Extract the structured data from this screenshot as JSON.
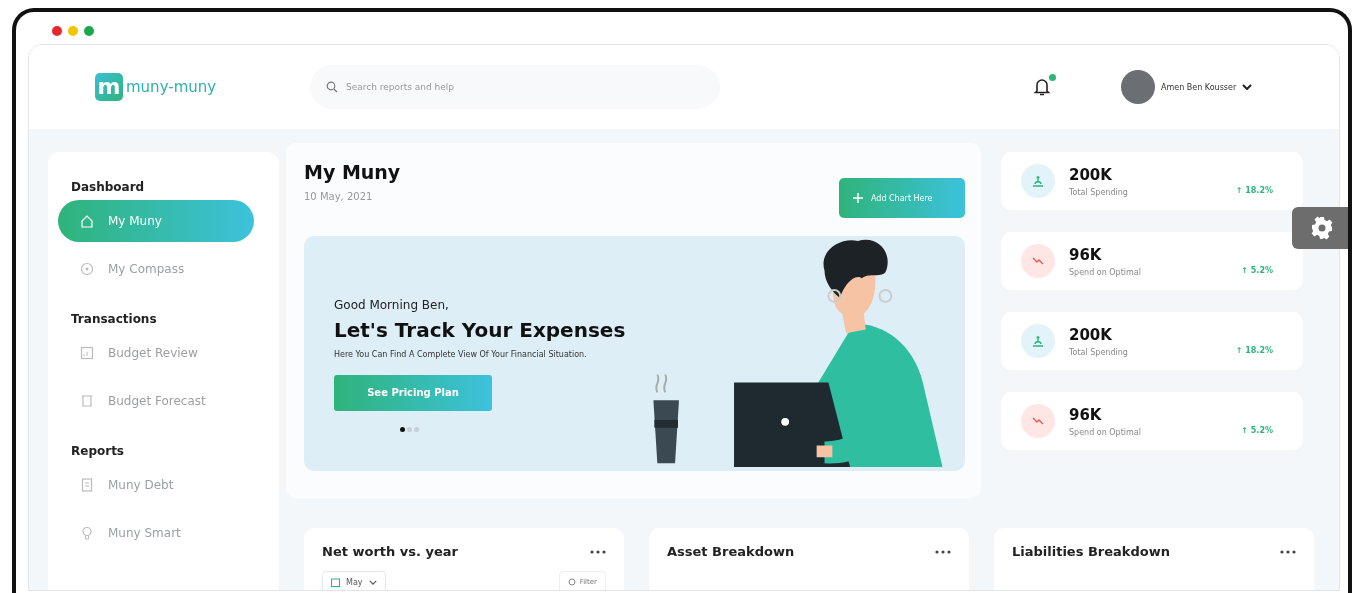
{
  "window": {
    "controls": [
      {
        "color": "#e8262b"
      },
      {
        "color": "#f2c500"
      },
      {
        "color": "#1fa64a"
      }
    ]
  },
  "header": {
    "logo": {
      "mark": "m",
      "text": "muny-muny"
    },
    "search": {
      "placeholder": "Search reports and help"
    },
    "notifications": {
      "unread": true
    },
    "user": {
      "name": "Amen Ben Kousser"
    }
  },
  "sidebar": {
    "sections": [
      {
        "title": "Dashboard",
        "items": [
          {
            "label": "My Muny",
            "selected": true
          },
          {
            "label": "My Compass",
            "selected": false
          }
        ]
      },
      {
        "title": "Transactions",
        "items": [
          {
            "label": "Budget Review",
            "selected": false
          },
          {
            "label": "Budget Forecast",
            "selected": false
          }
        ]
      },
      {
        "title": "Reports",
        "items": [
          {
            "label": "Muny Debt",
            "selected": false
          },
          {
            "label": "Muny Smart",
            "selected": false
          }
        ]
      }
    ]
  },
  "main": {
    "title": "My Muny",
    "date": "10 May, 2021",
    "add_button": "Add Chart Here",
    "banner": {
      "greeting": "Good Morning Ben,",
      "headline": "Let's Track Your Expenses",
      "subtitle": "Here You Can Find A Complete View Of Your Financial Situation.",
      "button": "See Pricing Plan",
      "pager": [
        {
          "selected": true
        },
        {
          "selected": false
        },
        {
          "selected": false
        }
      ]
    }
  },
  "stats": [
    {
      "kind": "spending",
      "value": "200K",
      "label": "Total Spending",
      "change": "↑ 18.2%"
    },
    {
      "kind": "optimal",
      "value": "96K",
      "label": "Spend on Optimal",
      "change": "↑ 5.2%"
    },
    {
      "kind": "spending",
      "value": "200K",
      "label": "Total Spending",
      "change": "↑ 18.2%"
    },
    {
      "kind": "optimal",
      "value": "96K",
      "label": "Spend on Optimal",
      "change": "↑ 5.2%"
    }
  ],
  "cards": [
    {
      "title": "Net worth vs. year",
      "dropdown": "May",
      "filter": "Filter"
    },
    {
      "title": "Asset Breakdown"
    },
    {
      "title": "Liabilities Breakdown"
    }
  ]
}
